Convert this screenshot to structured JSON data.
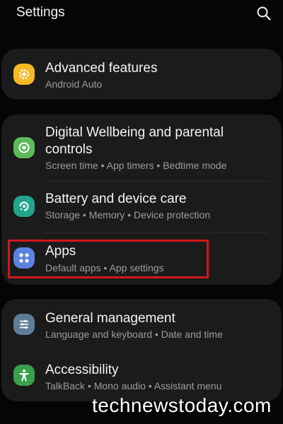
{
  "header": {
    "title": "Settings",
    "search_icon": "search-icon"
  },
  "sections": [
    {
      "items": [
        {
          "label": "Advanced features",
          "sub": "Android Auto",
          "icon": "gear-plus-icon",
          "color": "#f5b923"
        }
      ]
    },
    {
      "items": [
        {
          "label_line1": "Digital Wellbeing and parental",
          "label_line2": "controls",
          "sub": "Screen time  •  App timers  •  Bedtime mode",
          "icon": "wellbeing-icon",
          "color": "#5dbb5a"
        },
        {
          "label": "Battery and device care",
          "sub": "Storage  •  Memory  •  Device protection",
          "icon": "device-care-icon",
          "color": "#23a58d"
        },
        {
          "label": "Apps",
          "sub": "Default apps  •  App settings",
          "icon": "apps-icon",
          "color": "#5b82e0"
        }
      ]
    },
    {
      "items": [
        {
          "label": "General management",
          "sub": "Language and keyboard  •  Date and time",
          "icon": "sliders-icon",
          "color": "#5f7d97"
        },
        {
          "label": "Accessibility",
          "sub": "TalkBack  •  Mono audio  •  Assistant menu",
          "icon": "accessibility-icon",
          "color": "#3aa04b"
        }
      ]
    }
  ],
  "highlight_color": "#d0171f",
  "watermark": "technewstoday.com"
}
